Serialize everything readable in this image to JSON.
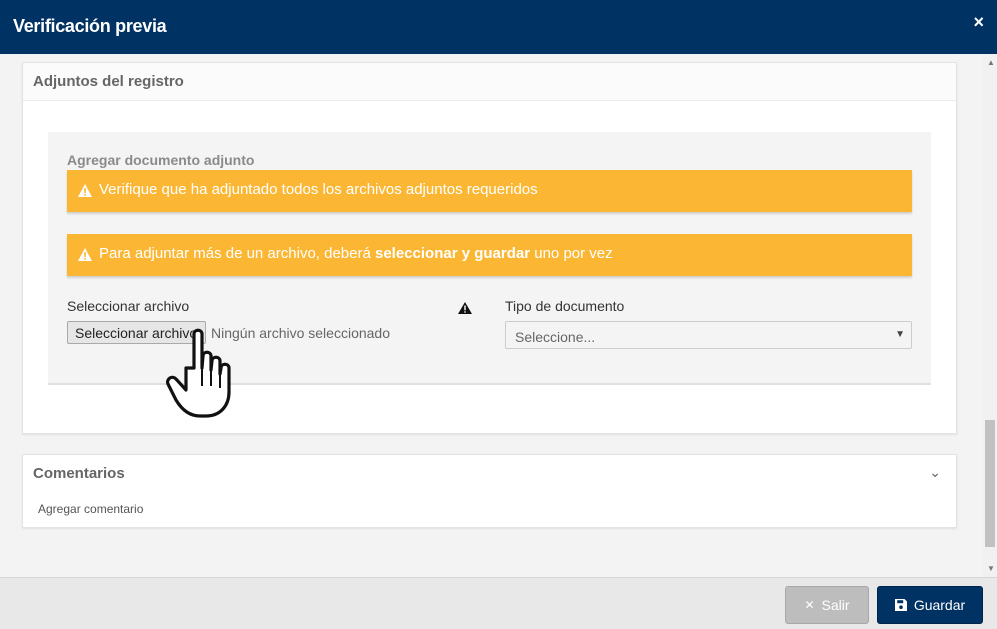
{
  "header": {
    "title": "Verificación previa",
    "close_icon": "×"
  },
  "attachments": {
    "title": "Adjuntos del registro",
    "subtitle": "Agregar documento adjunto",
    "alert1": "Verifique que ha adjuntado todos los archivos adjuntos requeridos",
    "alert2_pre": "Para adjuntar más de un archivo, deberá ",
    "alert2_bold": "seleccionar y guardar",
    "alert2_post": " uno por vez",
    "file_label": "Seleccionar archivo",
    "file_button": "Seleccionar archivo",
    "file_status": "Ningún archivo seleccionado",
    "doc_label": "Tipo de documento",
    "doc_placeholder": "Seleccione...",
    "alert_color": "#fbb734"
  },
  "comments": {
    "title": "Comentarios",
    "add_link": "Agregar comentario"
  },
  "footer": {
    "exit_label": "Salir",
    "save_label": "Guardar",
    "primary_color": "#003263"
  }
}
